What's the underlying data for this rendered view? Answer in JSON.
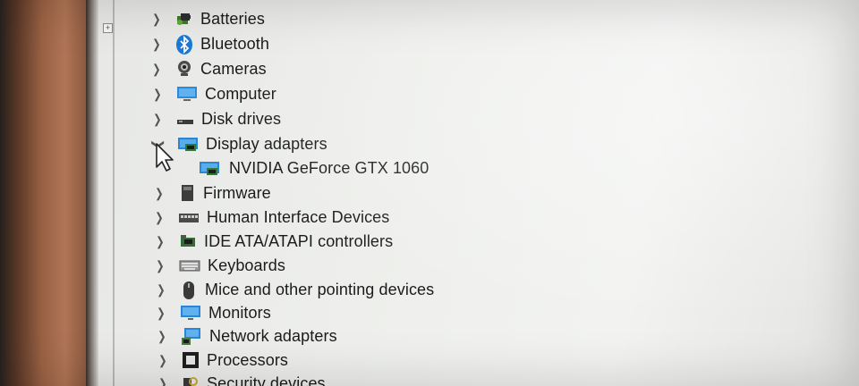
{
  "device_manager": {
    "expand_glyph": "+",
    "categories": [
      {
        "label": "Batteries",
        "icon": "battery-icon",
        "expanded": false
      },
      {
        "label": "Bluetooth",
        "icon": "bluetooth-icon",
        "expanded": false
      },
      {
        "label": "Cameras",
        "icon": "camera-icon",
        "expanded": false
      },
      {
        "label": "Computer",
        "icon": "computer-icon",
        "expanded": false
      },
      {
        "label": "Disk drives",
        "icon": "disk-drive-icon",
        "expanded": false
      },
      {
        "label": "Display adapters",
        "icon": "display-adapter-icon",
        "expanded": true,
        "children": [
          {
            "label": "NVIDIA GeForce GTX 1060",
            "icon": "display-adapter-icon"
          }
        ]
      },
      {
        "label": "Firmware",
        "icon": "firmware-icon",
        "expanded": false
      },
      {
        "label": "Human Interface Devices",
        "icon": "hid-icon",
        "expanded": false
      },
      {
        "label": "IDE ATA/ATAPI controllers",
        "icon": "ide-controller-icon",
        "expanded": false
      },
      {
        "label": "Keyboards",
        "icon": "keyboard-icon",
        "expanded": false
      },
      {
        "label": "Mice and other pointing devices",
        "icon": "mouse-icon",
        "expanded": false
      },
      {
        "label": "Monitors",
        "icon": "monitor-icon",
        "expanded": false
      },
      {
        "label": "Network adapters",
        "icon": "network-adapter-icon",
        "expanded": false
      },
      {
        "label": "Processors",
        "icon": "processor-icon",
        "expanded": false
      },
      {
        "label": "Security devices",
        "icon": "security-device-icon",
        "expanded": false
      }
    ]
  },
  "colors": {
    "text": "#1b1b1b",
    "background": "#eeefec",
    "accent_blue": "#1e78d6"
  }
}
